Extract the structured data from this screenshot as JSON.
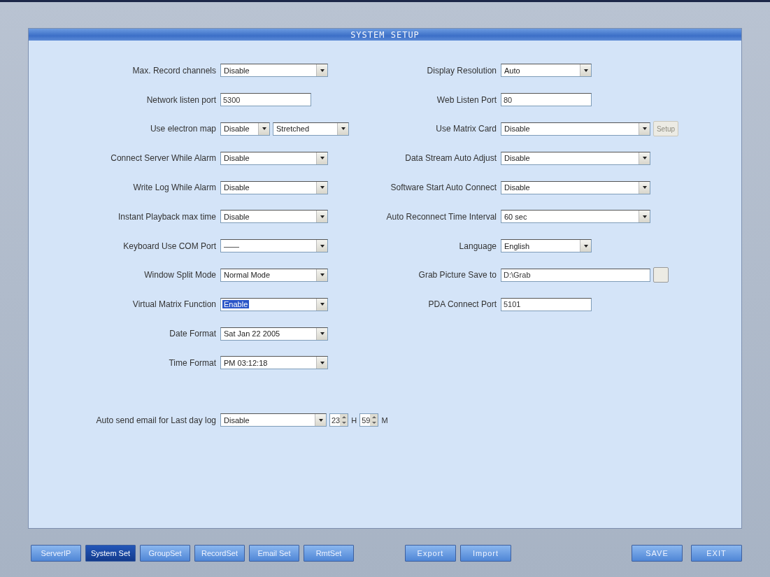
{
  "window": {
    "title": "SYSTEM SETUP"
  },
  "left_fields": [
    {
      "label": "Max. Record channels",
      "kind": "select",
      "value": "Disable"
    },
    {
      "label": "Network listen port",
      "kind": "text",
      "value": "5300"
    },
    {
      "label": "Use electron map",
      "kind": "pair",
      "value": "Disable",
      "value_2": "Stretched"
    },
    {
      "label": "Connect Server While Alarm",
      "kind": "select",
      "value": "Disable"
    },
    {
      "label": "Write Log While Alarm",
      "kind": "select",
      "value": "Disable"
    },
    {
      "label": "Instant Playback max time",
      "kind": "select",
      "value": "Disable"
    },
    {
      "label": "Keyboard Use COM Port",
      "kind": "select",
      "value": "——"
    },
    {
      "label": "Window Split Mode",
      "kind": "select",
      "value": "Normal Mode"
    },
    {
      "label": "Virtual Matrix Function",
      "kind": "select",
      "value": "Enable",
      "highlighted": true
    },
    {
      "label": "Date Format",
      "kind": "select",
      "value": "Sat Jan 22 2005"
    },
    {
      "label": "Time Format",
      "kind": "select",
      "value": "PM 03:12:18"
    }
  ],
  "email_row": {
    "label": "Auto send email for Last day log",
    "value": "Disable",
    "hour": "23",
    "hour_unit": "H",
    "minute": "59",
    "minute_unit": "M"
  },
  "right_fields": [
    {
      "label": "Display Resolution",
      "kind": "shortselect",
      "value": "Auto"
    },
    {
      "label": "Web Listen Port",
      "kind": "text",
      "value": "80"
    },
    {
      "label": "Use Matrix Card",
      "kind": "setup",
      "value": "Disable",
      "button": "Setup",
      "disabled": true
    },
    {
      "label": "Data Stream Auto Adjust",
      "kind": "longselect",
      "value": "Disable"
    },
    {
      "label": "Software Start Auto Connect",
      "kind": "longselect",
      "value": "Disable"
    },
    {
      "label": "Auto Reconnect Time Interval",
      "kind": "longselect",
      "value": "60 sec"
    },
    {
      "label": "Language",
      "kind": "shortselect",
      "value": "English"
    },
    {
      "label": "Grab Picture Save to",
      "kind": "browse",
      "value": "D:\\Grab"
    },
    {
      "label": "PDA Connect Port",
      "kind": "text",
      "value": "5101"
    }
  ],
  "tabs": [
    {
      "label": "ServerIP",
      "selected": false
    },
    {
      "label": "System Set",
      "selected": true
    },
    {
      "label": "GroupSet",
      "selected": false
    },
    {
      "label": "RecordSet",
      "selected": false
    },
    {
      "label": "Email Set",
      "selected": false
    },
    {
      "label": "RmtSet",
      "selected": false
    }
  ],
  "io_buttons": [
    "Export",
    "Import"
  ],
  "action_buttons": [
    "SAVE",
    "EXIT"
  ]
}
